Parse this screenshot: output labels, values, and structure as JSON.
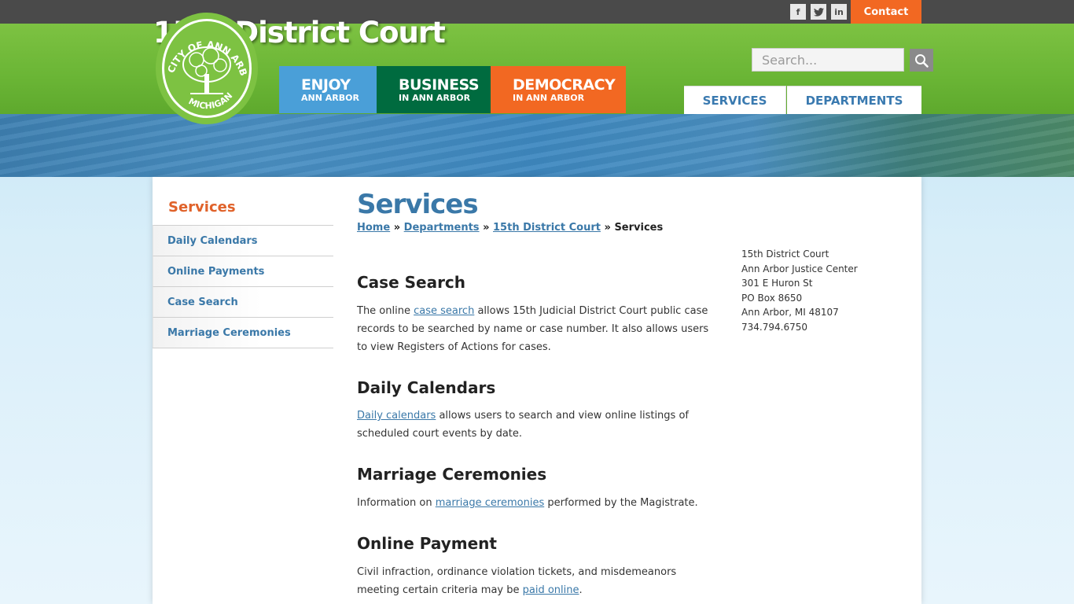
{
  "topbar": {
    "social": [
      {
        "icon": "facebook-icon",
        "glyph": "f"
      },
      {
        "icon": "twitter-icon",
        "glyph": "t"
      },
      {
        "icon": "linkedin-icon",
        "glyph": "in"
      }
    ],
    "contact_label": "Contact"
  },
  "colors": {
    "green": "#7dc242",
    "orange": "#f26822",
    "blue_link": "#3a78a8",
    "enjoy": "#4a9fd8",
    "business": "#006b3f",
    "democracy": "#f26822"
  },
  "seal": {
    "top_text": "CITY OF ANN ARBOR",
    "bottom_text": "MICHIGAN"
  },
  "nav": [
    {
      "big": "ENJOY",
      "small": "ANN ARBOR"
    },
    {
      "big": "BUSINESS",
      "small": "IN ANN ARBOR"
    },
    {
      "big": "DEMOCRACY",
      "small": "IN ANN ARBOR"
    }
  ],
  "search": {
    "placeholder": "Search..."
  },
  "tabs": [
    {
      "label": "SERVICES"
    },
    {
      "label": "DEPARTMENTS"
    }
  ],
  "banner": {
    "title": "15th District Court"
  },
  "sidebar": {
    "heading": "Services",
    "items": [
      {
        "label": "Daily Calendars"
      },
      {
        "label": "Online Payments"
      },
      {
        "label": "Case Search"
      },
      {
        "label": "Marriage Ceremonies"
      }
    ]
  },
  "main": {
    "title": "Services",
    "breadcrumb": {
      "home": "Home",
      "departments": "Departments",
      "court": "15th District Court",
      "sep": "»",
      "current": "Services"
    },
    "sections": [
      {
        "heading": "Case Search",
        "pre": "The online ",
        "link": "case search",
        "post": " allows 15th Judicial District Court public case records to be searched by name or case number. It also allows users to view Registers of Actions for cases."
      },
      {
        "heading": "Daily Calendars",
        "pre": "",
        "link": "Daily calendars",
        "post": " allows users to search and view online listings of scheduled court events by date."
      },
      {
        "heading": "Marriage Ceremonies",
        "pre": "Information on ",
        "link": "marriage ceremonies",
        "post": " performed by the Magistrate."
      },
      {
        "heading": "Online Payment",
        "pre": "Civil infraction, ordinance violation tickets, and misdemeanors meeting certain criteria may be ",
        "link": "paid online",
        "post": "."
      }
    ]
  },
  "address": {
    "line1": "15th District Court",
    "line2": "Ann Arbor Justice Center",
    "line3": "301 E Huron St",
    "line4": "PO Box 8650",
    "line5": "Ann Arbor, MI 48107",
    "line6": "734.794.6750"
  }
}
